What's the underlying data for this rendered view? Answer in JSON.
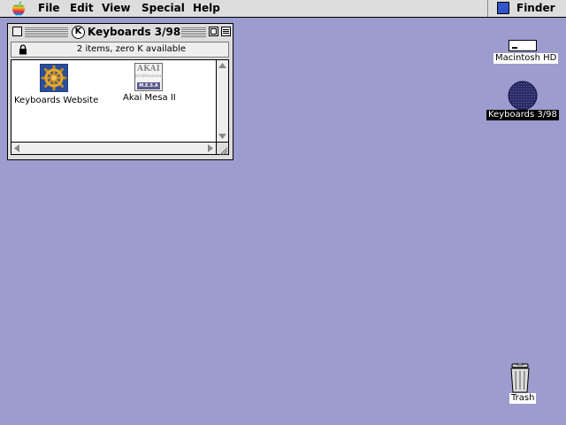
{
  "menubar": {
    "items": [
      "File",
      "Edit",
      "View",
      "Special",
      "Help"
    ],
    "app": "Finder"
  },
  "window": {
    "title": "Keyboards 3/98",
    "title_badge": "K",
    "info": "2 items, zero K available",
    "files": [
      {
        "label": "Keyboards Website",
        "icon": "ship-wheel-icon"
      },
      {
        "label": "Akai Mesa II",
        "icon": "akai-logo-icon",
        "logo_top": "AKAI",
        "logo_mid": "professional",
        "logo_bottom": "M.E.S.A"
      }
    ]
  },
  "desktop": {
    "icons": [
      {
        "label": "Macintosh HD",
        "icon": "hard-drive-icon"
      },
      {
        "label": "Keyboards 3/98",
        "icon": "disk-icon",
        "selected": true
      },
      {
        "label": "Trash",
        "icon": "trash-icon"
      }
    ]
  },
  "colors": {
    "desktop": "#9C9CCE",
    "selection": "#000000",
    "disk": "#2A2A66"
  }
}
